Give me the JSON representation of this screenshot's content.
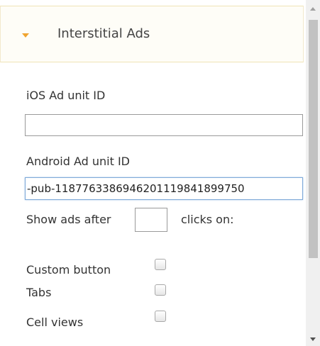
{
  "section": {
    "title": "Interstitial Ads",
    "expanded": true
  },
  "ios": {
    "label": "iOS Ad unit ID",
    "value": ""
  },
  "android": {
    "label": "Android Ad unit ID",
    "value": "-pub-1187763386946201119841899750"
  },
  "show_ads": {
    "prefix": "Show ads after",
    "value": "",
    "suffix": "clicks on:"
  },
  "options": [
    {
      "label": "Custom button",
      "checked": false
    },
    {
      "label": "Tabs",
      "checked": false
    },
    {
      "label": "Cell views",
      "checked": false
    }
  ],
  "colors": {
    "accent": "#f0a430",
    "focus": "#7ea9d8",
    "header_border": "#f0e3b6"
  },
  "icons": {
    "caret": "caret-down-icon"
  }
}
